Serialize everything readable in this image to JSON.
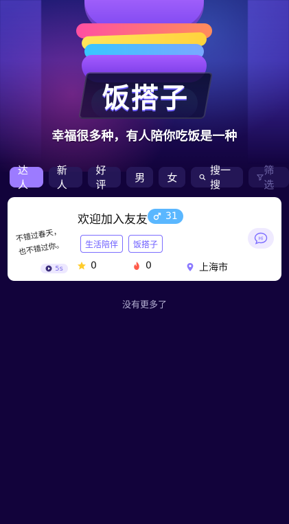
{
  "hero": {
    "logo_text": "饭搭子",
    "slogan": "幸福很多种，有人陪你吃饭是一种"
  },
  "tabs": [
    {
      "label": "达人",
      "active": true
    },
    {
      "label": "新人",
      "active": false
    },
    {
      "label": "好评",
      "active": false
    },
    {
      "label": "男",
      "active": false
    },
    {
      "label": "女",
      "active": false
    },
    {
      "label": "搜一搜",
      "icon": "search-icon"
    },
    {
      "label": "筛选",
      "icon": "filter-icon"
    }
  ],
  "card": {
    "avatar_script_lines": [
      "不错过春天，",
      "也不错过你。"
    ],
    "name": "欢迎加入友友",
    "gender_icon": "male-icon",
    "age": "31",
    "tags": [
      "生活陪伴",
      "饭搭子"
    ],
    "voice_duration": "5s",
    "likes": "0",
    "hot": "0",
    "location": "上海市",
    "chat_badge": "Hi"
  },
  "footer": {
    "no_more_text": "没有更多了"
  },
  "colors": {
    "accent": "#9c7bff",
    "bg": "#12033b",
    "age_badge": "#5ab7ff",
    "tag_border": "#7b6cff"
  }
}
